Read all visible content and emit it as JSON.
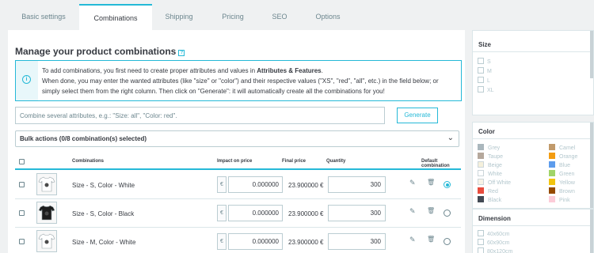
{
  "tabs": [
    {
      "label": "Basic settings"
    },
    {
      "label": "Combinations"
    },
    {
      "label": "Shipping"
    },
    {
      "label": "Pricing"
    },
    {
      "label": "SEO"
    },
    {
      "label": "Options"
    }
  ],
  "main": {
    "title": "Manage your product combinations",
    "help_icon": "?",
    "info_icon": "i",
    "info_line1_pre": "To add combinations, you first need to create proper attributes and values in ",
    "info_line1_bold": "Attributes & Features",
    "info_line1_post": ".",
    "info_line2": "When done, you may enter the wanted attributes (like \"size\" or \"color\") and their respective values (\"XS\", \"red\", \"all\", etc.) in the field below; or",
    "info_line3": "simply select them from the right column. Then click on \"Generate\": it will automatically create all the combinations for you!",
    "attr_placeholder": "Combine several attributes, e.g.: \"Size: all\", \"Color: red\".",
    "generate_label": "Generate",
    "bulk_label": "Bulk actions (0/8 combination(s) selected)",
    "chevron_icon": "⌄"
  },
  "table": {
    "headers": {
      "combinations": "Combinations",
      "impact": "Impact on price",
      "final": "Final price",
      "quantity": "Quantity",
      "default": "Default combination"
    },
    "rows": [
      {
        "name": "Size - S, Color - White",
        "currency": "€",
        "impact": "0.000000",
        "final": "23.900000 €",
        "qty": "300",
        "default": true,
        "shirt": "#ffffff"
      },
      {
        "name": "Size - S, Color - Black",
        "currency": "€",
        "impact": "0.000000",
        "final": "23.900000 €",
        "qty": "300",
        "default": false,
        "shirt": "#1d1d1d"
      },
      {
        "name": "Size - M, Color - White",
        "currency": "€",
        "impact": "0.000000",
        "final": "23.900000 €",
        "qty": "300",
        "default": false,
        "shirt": "#ffffff"
      }
    ],
    "edit_icon": "✎",
    "delete_icon": "🗑"
  },
  "sidebar": {
    "size": {
      "title": "Size",
      "options": [
        "S",
        "M",
        "L",
        "XL"
      ]
    },
    "color": {
      "title": "Color",
      "left": [
        {
          "label": "Grey",
          "color": "#aab7bd"
        },
        {
          "label": "Taupe",
          "color": "#b5a89c"
        },
        {
          "label": "Beige",
          "color": "#f5f0dc"
        },
        {
          "label": "White",
          "color": "#ffffff"
        },
        {
          "label": "Off White",
          "color": "#f8f3e6"
        },
        {
          "label": "Red",
          "color": "#e84c3d"
        },
        {
          "label": "Black",
          "color": "#434a54"
        }
      ],
      "right": [
        {
          "label": "Camel",
          "color": "#c19a6b"
        },
        {
          "label": "Orange",
          "color": "#f39c11"
        },
        {
          "label": "Blue",
          "color": "#5d9cec"
        },
        {
          "label": "Green",
          "color": "#a0d468"
        },
        {
          "label": "Yellow",
          "color": "#f1c40f"
        },
        {
          "label": "Brown",
          "color": "#964b00"
        },
        {
          "label": "Pink",
          "color": "#fcccd8"
        }
      ]
    },
    "dimension": {
      "title": "Dimension",
      "options": [
        "40x60cm",
        "60x90cm",
        "80x120cm"
      ]
    }
  },
  "colors": {
    "accent": "#25b9d7",
    "text": "#363a41",
    "muted": "#6c868e"
  }
}
